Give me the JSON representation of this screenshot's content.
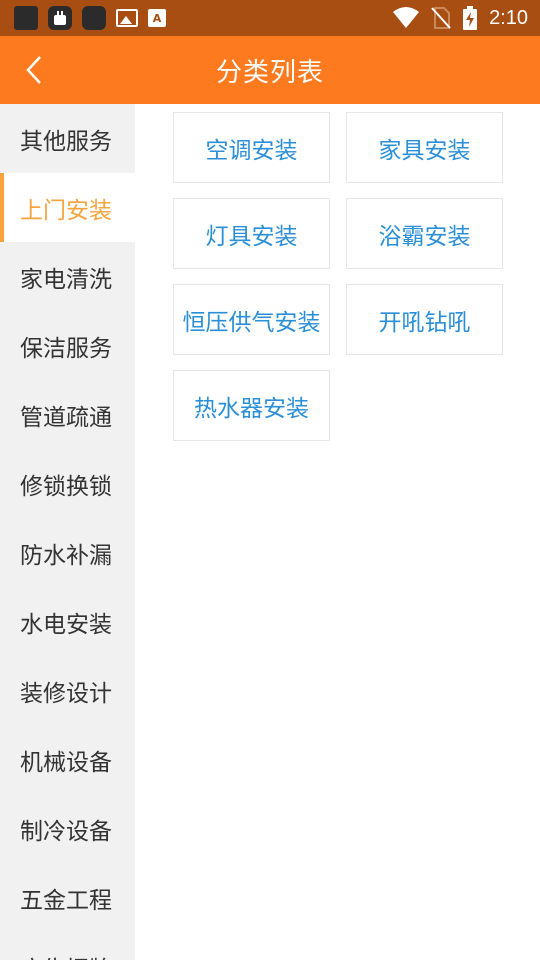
{
  "status_bar": {
    "time": "2:10",
    "icons": [
      "app-icon",
      "bag-icon",
      "app-icon",
      "image-icon",
      "a-icon",
      "wifi-icon",
      "no-sim-icon",
      "battery-charging-icon"
    ]
  },
  "header": {
    "title": "分类列表",
    "back_icon": "chevron-left-icon",
    "background": "#fd7a1e"
  },
  "sidebar": {
    "active_index": 1,
    "active_color": "#f7a43c",
    "items": [
      {
        "label": "其他服务"
      },
      {
        "label": "上门安装"
      },
      {
        "label": "家电清洗"
      },
      {
        "label": "保洁服务"
      },
      {
        "label": "管道疏通"
      },
      {
        "label": "修锁换锁"
      },
      {
        "label": "防水补漏"
      },
      {
        "label": "水电安装"
      },
      {
        "label": "装修设计"
      },
      {
        "label": "机械设备"
      },
      {
        "label": "制冷设备"
      },
      {
        "label": "五金工程"
      },
      {
        "label": "广告招牌"
      }
    ]
  },
  "categories": {
    "text_color": "#2a8fd6",
    "items": [
      {
        "label": "空调安装"
      },
      {
        "label": "家具安装"
      },
      {
        "label": "灯具安装"
      },
      {
        "label": "浴霸安装"
      },
      {
        "label": "恒压供气安装"
      },
      {
        "label": "开吼钻吼"
      },
      {
        "label": "热水器安装"
      }
    ]
  }
}
